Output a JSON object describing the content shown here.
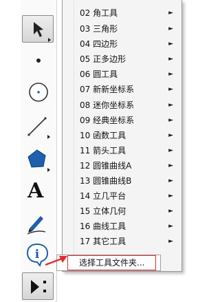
{
  "menu": {
    "items": [
      {
        "label": "02 角工具"
      },
      {
        "label": "03 三角形"
      },
      {
        "label": "04 四边形"
      },
      {
        "label": "05 正多边形"
      },
      {
        "label": "06 圆工具"
      },
      {
        "label": "07 新新坐标系"
      },
      {
        "label": "08 迷你坐标系"
      },
      {
        "label": "09 经典坐标系"
      },
      {
        "label": "10 函数工具"
      },
      {
        "label": "11 箭头工具"
      },
      {
        "label": "12 圆锥曲线A"
      },
      {
        "label": "13 圆锥曲线B"
      },
      {
        "label": "14 立几平台"
      },
      {
        "label": "15 立体几何"
      },
      {
        "label": "16 曲线工具"
      },
      {
        "label": "17 其它工具"
      }
    ],
    "submenu_arrow": "►"
  },
  "popup": {
    "label": "选择工具文件夹..."
  },
  "toolbar": {
    "text_tool_label": "A",
    "tools": [
      {
        "icon": "arrow-selection-icon"
      },
      {
        "icon": "point-icon"
      },
      {
        "icon": "compass-circle-icon"
      },
      {
        "icon": "straightedge-line-icon"
      },
      {
        "icon": "polygon-icon"
      },
      {
        "icon": "text-icon"
      },
      {
        "icon": "marker-pen-icon"
      },
      {
        "icon": "information-icon"
      },
      {
        "icon": "custom-tools-icon"
      }
    ]
  },
  "colors": {
    "highlight_border": "#e03030",
    "annotation_arrow": "#e03030",
    "polygon_fill": "#1e5fae"
  }
}
